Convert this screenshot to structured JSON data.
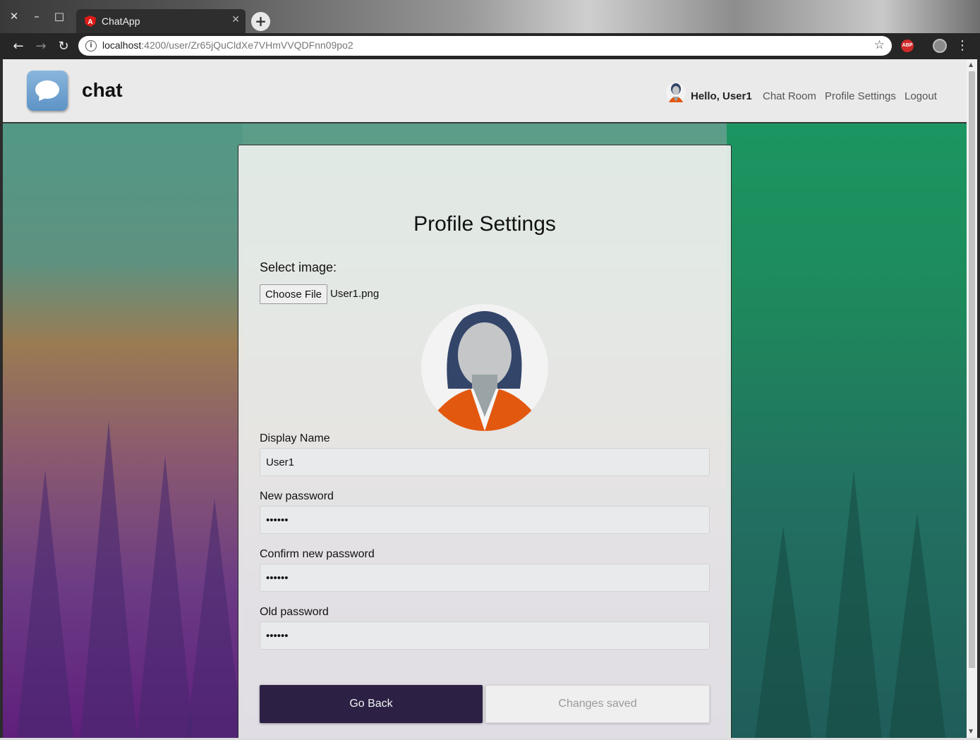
{
  "browser": {
    "tab_title": "ChatApp",
    "url_host": "localhost",
    "url_path": ":4200/user/Zr65jQuCldXe7VHmVVQDFnn09po2",
    "icons": {
      "close_window": "close-icon",
      "minimize": "minimize-icon",
      "maximize": "maximize-icon",
      "back": "back-arrow-icon",
      "forward": "forward-arrow-icon",
      "reload": "reload-icon",
      "info": "info-icon",
      "bookmark": "star-icon",
      "adblock": "abp-icon",
      "extension": "extension-icon",
      "menu": "kebab-menu-icon"
    },
    "abp_label": "ABP"
  },
  "navbar": {
    "brand": "chat",
    "greeting": "Hello, User1",
    "links": [
      "Chat Room",
      "Profile Settings",
      "Logout"
    ]
  },
  "profile": {
    "title": "Profile Settings",
    "select_image_label": "Select image:",
    "choose_file_label": "Choose File",
    "file_name": "User1.png",
    "display_name_label": "Display Name",
    "display_name_value": "User1",
    "new_password_label": "New password",
    "new_password_value": "••••••",
    "confirm_password_label": "Confirm new password",
    "confirm_password_value": "••••••",
    "old_password_label": "Old password",
    "old_password_value": "••••••",
    "go_back_label": "Go Back",
    "changes_saved_label": "Changes saved"
  },
  "colors": {
    "primary_button": "#2c2144",
    "avatar_hair": "#34456a",
    "avatar_shirt": "#e2580f",
    "logo_blue": "#5d93c6"
  }
}
